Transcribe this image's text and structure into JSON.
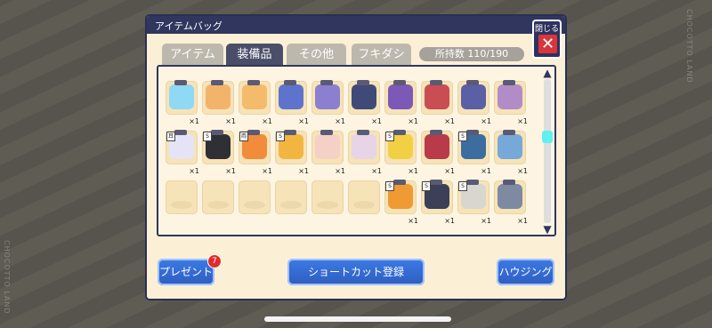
{
  "window": {
    "title": "アイテムバッグ",
    "close_label": "閉じる",
    "close_symbol": "✕"
  },
  "tabs": [
    {
      "label": "アイテム",
      "active": false
    },
    {
      "label": "装備品",
      "active": true
    },
    {
      "label": "その他",
      "active": false
    },
    {
      "label": "フキダシ",
      "active": false
    }
  ],
  "holding": {
    "label": "所持数",
    "value": "110/190"
  },
  "grid": {
    "rows": [
      {
        "items": [
          {
            "name": "item-1",
            "color": "#8fd9f4",
            "count": "×1",
            "badge": ""
          },
          {
            "name": "item-2",
            "color": "#f2b36a",
            "count": "×1",
            "badge": ""
          },
          {
            "name": "item-3",
            "color": "#f4bb6a",
            "count": "×1",
            "badge": ""
          },
          {
            "name": "item-4",
            "color": "#5e74cc",
            "count": "×1",
            "badge": ""
          },
          {
            "name": "item-5",
            "color": "#8b7fd0",
            "count": "×1",
            "badge": ""
          },
          {
            "name": "item-6",
            "color": "#3f4a78",
            "count": "×1",
            "badge": ""
          },
          {
            "name": "item-7",
            "color": "#7d59b7",
            "count": "×1",
            "badge": ""
          },
          {
            "name": "item-8",
            "color": "#c94d53",
            "count": "×1",
            "badge": ""
          },
          {
            "name": "item-9",
            "color": "#5b5fa5",
            "count": "×1",
            "badge": ""
          },
          {
            "name": "item-10",
            "color": "#b28cc7",
            "count": "×1",
            "badge": ""
          }
        ]
      },
      {
        "items": [
          {
            "name": "item-11",
            "color": "#e5e4f7",
            "count": "×1",
            "badge": "耳"
          },
          {
            "name": "item-12",
            "color": "#2f2f36",
            "count": "×1",
            "badge": "S"
          },
          {
            "name": "item-13",
            "color": "#f08c3a",
            "count": "×1",
            "badge": "両"
          },
          {
            "name": "item-14",
            "color": "#f2b640",
            "count": "×1",
            "badge": "S"
          },
          {
            "name": "item-15",
            "color": "#f5d0c6",
            "count": "×1",
            "badge": ""
          },
          {
            "name": "item-16",
            "color": "#e8d4e7",
            "count": "×1",
            "badge": ""
          },
          {
            "name": "item-17",
            "color": "#f1d143",
            "count": "×1",
            "badge": "S"
          },
          {
            "name": "item-18",
            "color": "#b93a48",
            "count": "×1",
            "badge": ""
          },
          {
            "name": "item-19",
            "color": "#3d6d9f",
            "count": "×1",
            "badge": "S"
          },
          {
            "name": "item-20",
            "color": "#76a8d8",
            "count": "×1",
            "badge": ""
          }
        ]
      },
      {
        "items": [
          {
            "name": "empty-1",
            "color": "",
            "count": "",
            "badge": ""
          },
          {
            "name": "empty-2",
            "color": "",
            "count": "",
            "badge": ""
          },
          {
            "name": "empty-3",
            "color": "",
            "count": "",
            "badge": ""
          },
          {
            "name": "empty-4",
            "color": "",
            "count": "",
            "badge": ""
          },
          {
            "name": "empty-5",
            "color": "",
            "count": "",
            "badge": ""
          },
          {
            "name": "empty-6",
            "color": "",
            "count": "",
            "badge": ""
          },
          {
            "name": "item-21",
            "color": "#f09a33",
            "count": "×1",
            "badge": "S"
          },
          {
            "name": "item-22",
            "color": "#3b3f57",
            "count": "×1",
            "badge": "S"
          },
          {
            "name": "item-23",
            "color": "#d9d5cf",
            "count": "×1",
            "badge": "S"
          },
          {
            "name": "item-24",
            "color": "#7d8aa2",
            "count": "×1",
            "badge": ""
          }
        ]
      }
    ]
  },
  "buttons": {
    "present": "プレゼント",
    "present_badge": "7",
    "shortcut": "ショートカット登録",
    "housing": "ハウジング"
  },
  "watermark": "CHOCOTTO LAND",
  "colors": {
    "window_bg": "#fbf0d6",
    "title_bg": "#30365e",
    "tab_active": "#4b4e68",
    "button": "#2f5dbf",
    "close": "#d8363b"
  }
}
